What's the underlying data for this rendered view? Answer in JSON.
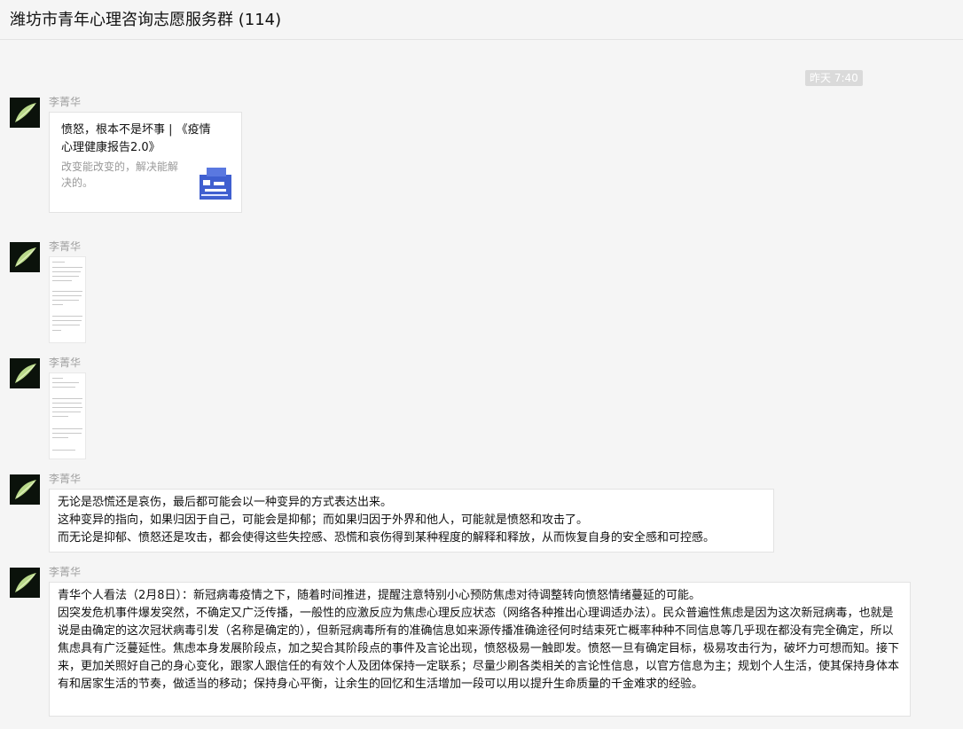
{
  "window": {
    "title": "潍坊市青年心理咨询志愿服务群 (114)"
  },
  "timestamp": "昨天 7:40",
  "messages": [
    {
      "sender": "李菁华",
      "type": "link-card",
      "card": {
        "title": "愤怒，根本不是坏事 | 《疫情心理健康报告2.0》",
        "description": "改变能改变的，解决能解决的。"
      }
    },
    {
      "sender": "李菁华",
      "type": "image"
    },
    {
      "sender": "李菁华",
      "type": "image"
    },
    {
      "sender": "李菁华",
      "type": "text",
      "lines": [
        "无论是恐慌还是哀伤，最后都可能会以一种变异的方式表达出来。",
        "这种变异的指向，如果归因于自己，可能会是抑郁；而如果归因于外界和他人，可能就是愤怒和攻击了。",
        "而无论是抑郁、愤怒还是攻击，都会使得这些失控感、恐慌和哀伤得到某种程度的解释和释放，从而恢复自身的安全感和可控感。"
      ]
    },
    {
      "sender": "李菁华",
      "type": "text",
      "paragraphs": [
        "青华个人看法（2月8日）：新冠病毒疫情之下，随着时间推进，提醒注意特别小心预防焦虑对待调整转向愤怒情绪蔓延的可能。",
        "因突发危机事件爆发突然，不确定又广泛传播，一般性的应激反应为焦虑心理反应状态（网络各种推出心理调适办法）。民众普遍性焦虑是因为这次新冠病毒，也就是说是由确定的这次冠状病毒引发（名称是确定的），但新冠病毒所有的准确信息如来源传播准确途径何时结束死亡概率种种不同信息等几乎现在都没有完全确定，所以焦虑具有广泛蔓延性。焦虑本身发展阶段点，加之契合其阶段点的事件及言论出现，愤怒极易一触即发。愤怒一旦有确定目标，极易攻击行为，破坏力可想而知。接下来，更加关照好自己的身心变化，跟家人跟信任的有效个人及团体保持一定联系；尽量少刷各类相关的言论性信息，以官方信息为主；规划个人生活，使其保持身体本有和居家生活的节奏，做适当的移动；保持身心平衡，让余生的回忆和生活增加一段可以用以提升生命质量的千金难求的经验。"
      ]
    }
  ]
}
